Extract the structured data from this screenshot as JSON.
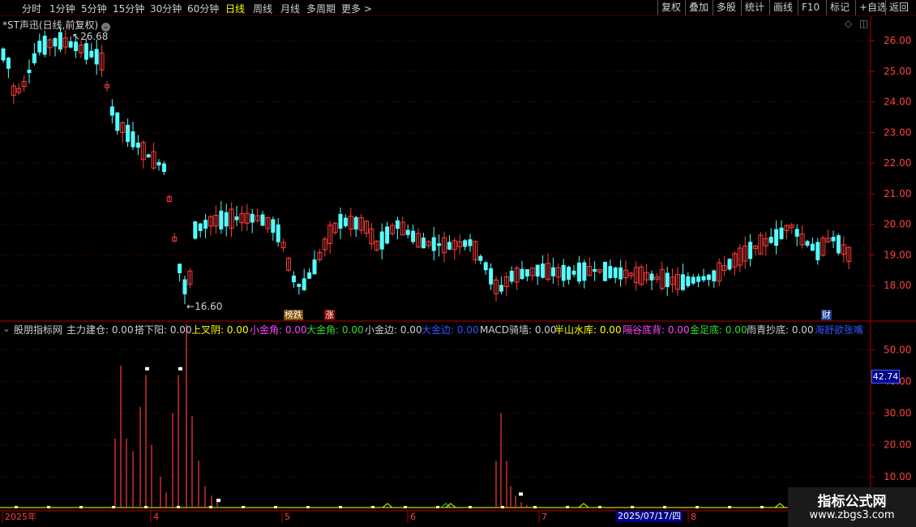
{
  "toolbar": {
    "left": [
      "分时",
      "1分钟",
      "5分钟",
      "15分钟",
      "30分钟",
      "60分钟",
      "日线",
      "周线",
      "月线",
      "多周期",
      "更多 >"
    ],
    "right": [
      "复权",
      "叠加",
      "多股",
      "统计",
      "画线",
      "F10",
      "标记",
      "+自选",
      "返回"
    ]
  },
  "header": {
    "title": "*ST声迅(日线,前复权)"
  },
  "price_chart": {
    "ymin": 17.0,
    "ymax": 26.8,
    "yticks": [
      "26.00",
      "25.00",
      "24.00",
      "23.00",
      "22.00",
      "21.00",
      "20.00",
      "19.00",
      "18.00"
    ],
    "high_label": "26.68",
    "low_label": "16.60",
    "badges": [
      "榜跌",
      "涨",
      "财"
    ]
  },
  "indicator": {
    "name": "股朋指标网",
    "items": [
      {
        "label": "主力建仓: 0.00",
        "color": "#d0d0d0"
      },
      {
        "label": "搭下阳: 0.00",
        "color": "#d0d0d0"
      },
      {
        "label": "上叉阴: 0.00",
        "color": "#ffff00"
      },
      {
        "label": "小金角: 0.00",
        "color": "#ff44ff"
      },
      {
        "label": "大金角: 0.00",
        "color": "#33dd33"
      },
      {
        "label": "小金边: 0.00",
        "color": "#d0d0d0"
      },
      {
        "label": "大金边: 0.00",
        "color": "#3355ff"
      },
      {
        "label": "MACD骑墙: 0.00",
        "color": "#d0d0d0"
      },
      {
        "label": "半山水库: 0.00",
        "color": "#ffff00"
      },
      {
        "label": "隔谷底背: 0.00",
        "color": "#ff44ff"
      },
      {
        "label": "金足底: 0.00",
        "color": "#33dd33"
      },
      {
        "label": "雨青抄底: 0.00",
        "color": "#d0d0d0"
      },
      {
        "label": "海舒欲张嘴",
        "color": "#3355ff"
      }
    ],
    "yticks": [
      "50.00",
      "40.00",
      "30.00",
      "20.00",
      "10.00"
    ],
    "current_value": "42.74"
  },
  "xaxis": {
    "labels": [
      "2025年",
      "4",
      "5",
      "6",
      "7",
      "8"
    ],
    "cursor_date": "2025/07/17/四"
  },
  "watermark": {
    "title": "指标公式网",
    "url": "www.zbgs3.com"
  },
  "colors": {
    "up": "#ff3b3b",
    "down": "#54ffff",
    "axis": "#b00000",
    "grid": "#6a0000",
    "bg": "#000000"
  }
}
